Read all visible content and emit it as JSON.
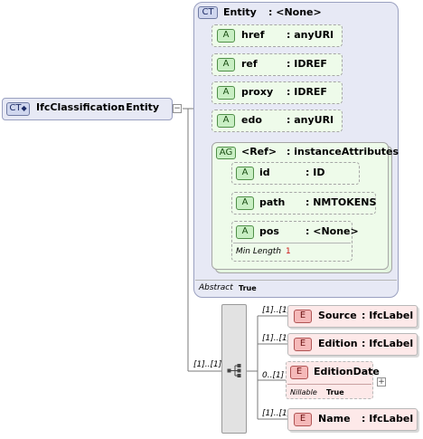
{
  "root": {
    "tag": "CT",
    "name": "IfcClassification",
    "type": ": Entity"
  },
  "entity": {
    "tag": "CT",
    "name": "Entity",
    "type": ": <None>",
    "attributes": [
      {
        "tag": "A",
        "name": "href",
        "type": ": anyURI"
      },
      {
        "tag": "A",
        "name": "ref",
        "type": ": IDREF"
      },
      {
        "tag": "A",
        "name": "proxy",
        "type": ": IDREF"
      },
      {
        "tag": "A",
        "name": "edo",
        "type": ": anyURI"
      }
    ],
    "group": {
      "tag": "AG",
      "name": "<Ref>",
      "type": ": instanceAttributes",
      "attributes": [
        {
          "tag": "A",
          "name": "id",
          "type": ": ID"
        },
        {
          "tag": "A",
          "name": "path",
          "type": ": NMTOKENS"
        },
        {
          "tag": "A",
          "name": "pos",
          "type": ": <None>",
          "facet_label": "Min Length",
          "facet_value": "1"
        }
      ]
    },
    "abstract_label": "Abstract",
    "abstract_value": "True"
  },
  "sequence": {
    "cardinality": "[1]..[1]",
    "icon": "sequence-compositor-icon",
    "elements": [
      {
        "tag": "E",
        "name": "Source",
        "type": ": IfcLabel",
        "cardinality": "[1]..[1]"
      },
      {
        "tag": "E",
        "name": "Edition",
        "type": ": IfcLabel",
        "cardinality": "[1]..[1]"
      },
      {
        "tag": "E",
        "name": "EditionDate",
        "type": "",
        "cardinality": "0..[1]",
        "nillable_label": "Nillable",
        "nillable_value": "True"
      },
      {
        "tag": "E",
        "name": "Name",
        "type": ": IfcLabel",
        "cardinality": "[1]..[1]"
      }
    ]
  },
  "colors": {
    "complex_type": "#e7e9f5",
    "attribute": "#eefbea",
    "element": "#fde9e9",
    "line": "#7a7a7a"
  }
}
